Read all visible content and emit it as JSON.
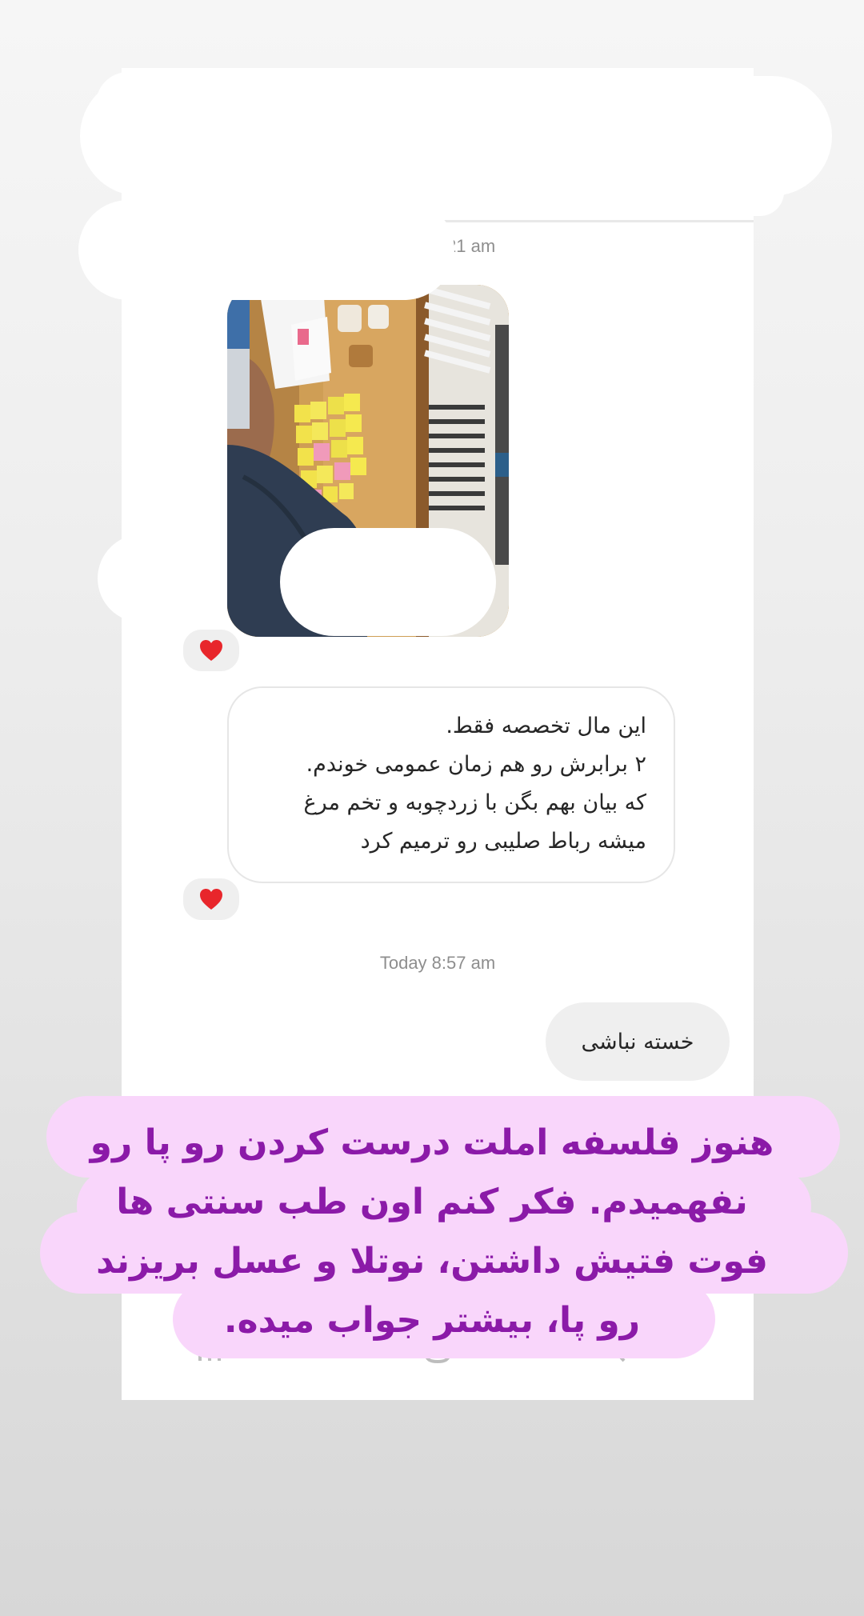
{
  "chat": {
    "timestamps": [
      "Today 7:21 am",
      "Today 8:57 am"
    ],
    "received_message_lines": [
      "این مال تخصصه فقط.",
      "۲ برابرش رو هم زمان عمومی خوندم.",
      "که بیان بهم بگن با زردچوبه و تخم مرغ",
      "میشه رباط صلیبی رو ترمیم کرد"
    ],
    "sent_message": "خسته نباشی",
    "reaction_icon": "heart-icon",
    "reaction_color": "#e8262b"
  },
  "caption": {
    "lines": [
      "هنوز فلسفه املت درست کردن رو پا رو",
      "نفهمیدم. فکر کنم اون طب سنتی ها",
      "فوت فتیش داشتن، نوتلا و عسل بریزند",
      "رو پا، بیشتر جواب میده."
    ],
    "text_color": "#8b1aa8",
    "background_color": "#f9d6fb"
  },
  "nav_bar": {
    "icons": [
      "recent-apps-icon",
      "home-icon",
      "back-icon"
    ]
  }
}
